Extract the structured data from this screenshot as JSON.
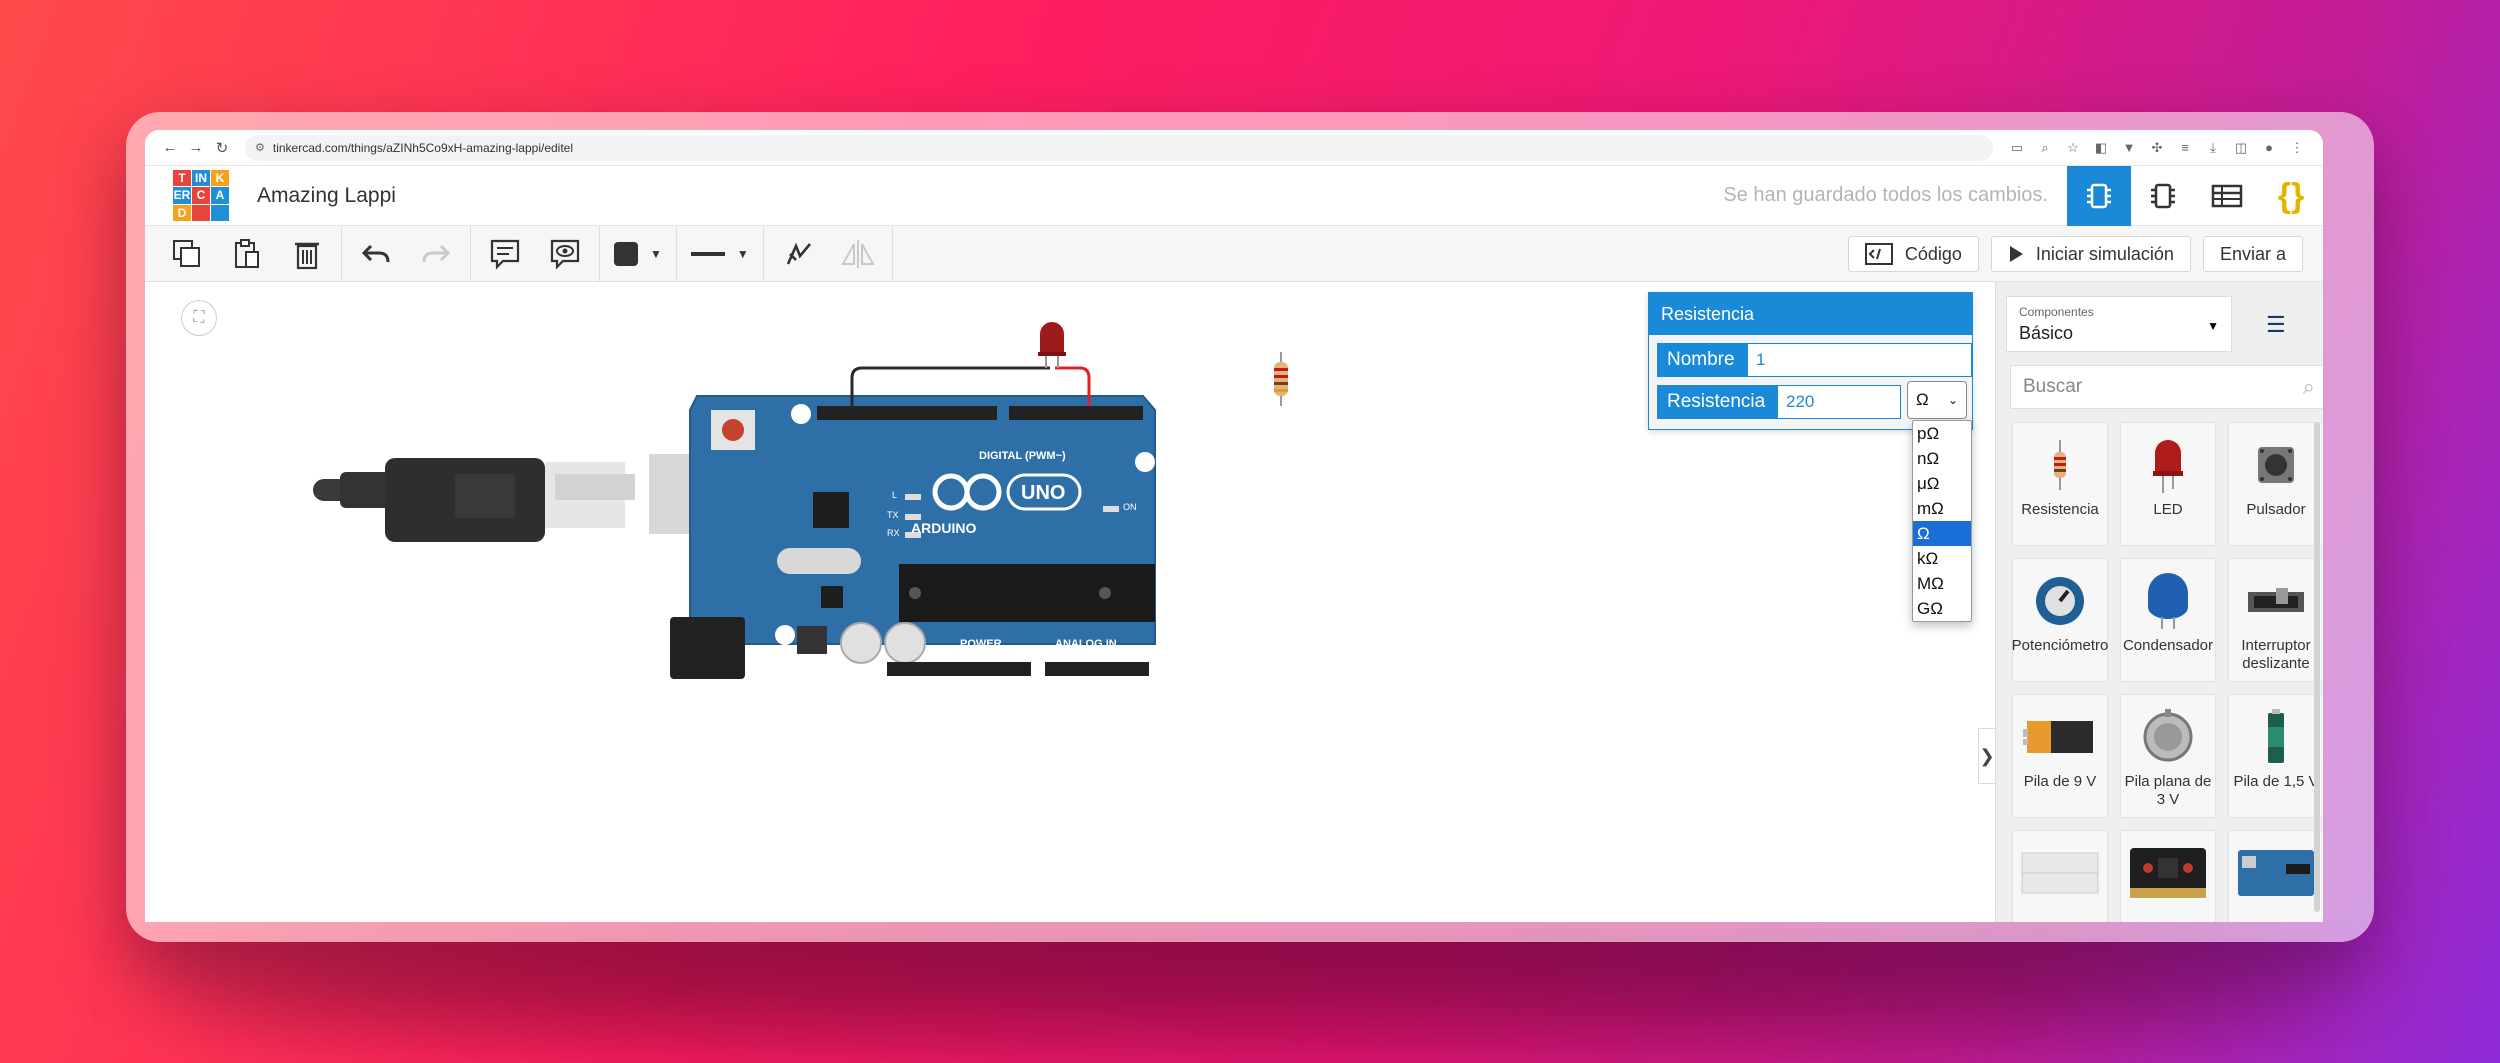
{
  "browser": {
    "url": "tinkercad.com/things/aZINh5Co9xH-amazing-lappi/editel"
  },
  "header": {
    "logo_letters": [
      "T",
      "IN",
      "K",
      "ER",
      "C",
      "A",
      "D",
      "",
      ""
    ],
    "project_title": "Amazing Lappi",
    "saved_status": "Se han guardado todos los cambios."
  },
  "toolbar": {
    "code_label": "Código",
    "simulate_label": "Iniciar simulación",
    "send_label": "Enviar a"
  },
  "properties": {
    "title": "Resistencia",
    "name_label": "Nombre",
    "name_value": "1",
    "resistance_label": "Resistencia",
    "resistance_value": "220",
    "unit_selected": "Ω",
    "unit_options": [
      "pΩ",
      "nΩ",
      "μΩ",
      "mΩ",
      "Ω",
      "kΩ",
      "MΩ",
      "GΩ"
    ]
  },
  "arduino": {
    "brand": "ARDUINO",
    "model": "UNO",
    "digital_label": "DIGITAL (PWM~)",
    "power_label": "POWER",
    "analog_label": "ANALOG IN",
    "on_label": "ON",
    "l_label": "L",
    "tx_label": "TX",
    "rx_label": "RX"
  },
  "components_panel": {
    "category_caption": "Componentes",
    "category_value": "Básico",
    "search_placeholder": "Buscar",
    "items": [
      {
        "label": "Resistencia"
      },
      {
        "label": "LED"
      },
      {
        "label": "Pulsador"
      },
      {
        "label": "Potenciómetro"
      },
      {
        "label": "Condensador"
      },
      {
        "label": "Interruptor deslizante"
      },
      {
        "label": "Pila de 9 V"
      },
      {
        "label": "Pila plana de 3 V"
      },
      {
        "label": "Pila de 1,5 V"
      },
      {
        "label": ""
      },
      {
        "label": ""
      },
      {
        "label": ""
      }
    ]
  },
  "colors": {
    "accent": "#1a8ad8",
    "board": "#2f6fa8",
    "logo_red": "#e8443a",
    "logo_blue": "#1f8fd6",
    "logo_orange": "#f5a31a"
  }
}
